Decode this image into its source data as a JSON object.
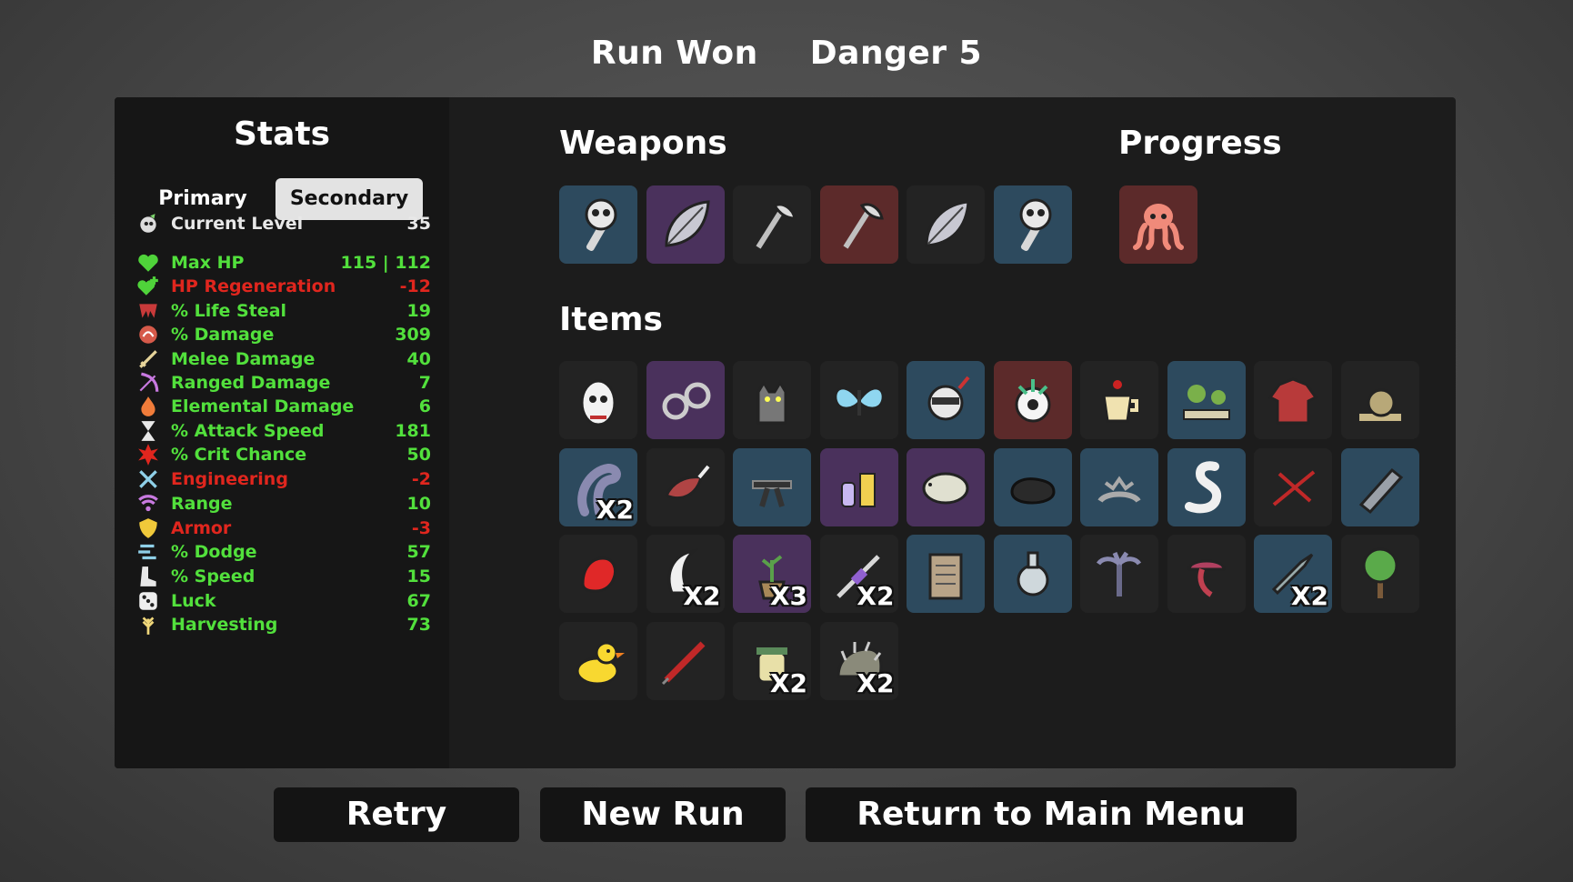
{
  "header": {
    "result": "Run Won",
    "danger": "Danger 5"
  },
  "stats": {
    "title": "Stats",
    "tab_primary": "Primary",
    "tab_secondary": "Secondary",
    "rows": [
      {
        "label": "Current Level",
        "value": "35",
        "color": "white",
        "icon": "level-icon"
      },
      {
        "label": "Max HP",
        "value": "115 | 112",
        "color": "green",
        "icon": "heart-icon"
      },
      {
        "label": "HP Regeneration",
        "value": "-12",
        "color": "red",
        "icon": "heart-plus-icon"
      },
      {
        "label": "% Life Steal",
        "value": "19",
        "color": "green",
        "icon": "fangs-icon"
      },
      {
        "label": "% Damage",
        "value": "309",
        "color": "green",
        "icon": "muscle-icon"
      },
      {
        "label": "Melee Damage",
        "value": "40",
        "color": "green",
        "icon": "sword-icon"
      },
      {
        "label": "Ranged Damage",
        "value": "7",
        "color": "green",
        "icon": "bow-icon"
      },
      {
        "label": "Elemental Damage",
        "value": "6",
        "color": "green",
        "icon": "flame-icon"
      },
      {
        "label": "% Attack Speed",
        "value": "181",
        "color": "green",
        "icon": "hourglass-icon"
      },
      {
        "label": "% Crit Chance",
        "value": "50",
        "color": "green",
        "icon": "crit-icon"
      },
      {
        "label": "Engineering",
        "value": "-2",
        "color": "red",
        "icon": "wrench-icon"
      },
      {
        "label": "Range",
        "value": "10",
        "color": "green",
        "icon": "range-icon"
      },
      {
        "label": "Armor",
        "value": "-3",
        "color": "red",
        "icon": "shield-icon"
      },
      {
        "label": "% Dodge",
        "value": "57",
        "color": "green",
        "icon": "dodge-icon"
      },
      {
        "label": "% Speed",
        "value": "15",
        "color": "green",
        "icon": "boot-icon"
      },
      {
        "label": "Luck",
        "value": "67",
        "color": "green",
        "icon": "dice-icon"
      },
      {
        "label": "Harvesting",
        "value": "73",
        "color": "green",
        "icon": "wheat-icon"
      }
    ]
  },
  "weapons": {
    "title": "Weapons",
    "items": [
      {
        "icon": "skull-wrench-icon",
        "tier": "tier2"
      },
      {
        "icon": "leaf-blade-icon",
        "tier": "tier3"
      },
      {
        "icon": "axe-icon",
        "tier": "tier1"
      },
      {
        "icon": "axe-icon",
        "tier": "tier4"
      },
      {
        "icon": "leaf-blade-icon",
        "tier": "tier1"
      },
      {
        "icon": "skull-wrench-icon",
        "tier": "tier2"
      }
    ]
  },
  "progress": {
    "title": "Progress",
    "items": [
      {
        "icon": "octopus-icon",
        "tier": "tier4"
      }
    ]
  },
  "items": {
    "title": "Items",
    "rows": [
      [
        {
          "icon": "egg-icon",
          "tier": "tier1",
          "qty": ""
        },
        {
          "icon": "handcuffs-icon",
          "tier": "tier3",
          "qty": ""
        },
        {
          "icon": "cat-icon",
          "tier": "tier1",
          "qty": ""
        },
        {
          "icon": "butterfly-icon",
          "tier": "tier1",
          "qty": ""
        },
        {
          "icon": "robot-icon",
          "tier": "tier2",
          "qty": ""
        },
        {
          "icon": "alien-eye-icon",
          "tier": "tier4",
          "qty": ""
        },
        {
          "icon": "coffee-icon",
          "tier": "tier1",
          "qty": ""
        },
        {
          "icon": "garden-icon",
          "tier": "tier2",
          "qty": ""
        },
        {
          "icon": "shirt-icon",
          "tier": "tier1",
          "qty": ""
        },
        {
          "icon": "snail-icon",
          "tier": "tier1",
          "qty": ""
        }
      ],
      [
        {
          "icon": "tentacle-icon",
          "tier": "tier2",
          "qty": "X2"
        },
        {
          "icon": "meat-icon",
          "tier": "tier1",
          "qty": ""
        },
        {
          "icon": "black-belt-icon",
          "tier": "tier2",
          "qty": ""
        },
        {
          "icon": "potion-set-icon",
          "tier": "tier3",
          "qty": ""
        },
        {
          "icon": "tardigrade-icon",
          "tier": "tier3",
          "qty": ""
        },
        {
          "icon": "stone-icon",
          "tier": "tier2",
          "qty": ""
        },
        {
          "icon": "crown-icon",
          "tier": "tier2",
          "qty": ""
        },
        {
          "icon": "worm-icon",
          "tier": "tier2",
          "qty": ""
        },
        {
          "icon": "scar-icon",
          "tier": "tier1",
          "qty": ""
        },
        {
          "icon": "plank-icon",
          "tier": "tier2",
          "qty": ""
        }
      ],
      [
        {
          "icon": "glove-icon",
          "tier": "tier1",
          "qty": ""
        },
        {
          "icon": "claw-icon",
          "tier": "tier1",
          "qty": "X2"
        },
        {
          "icon": "plant-pot-icon",
          "tier": "tier3",
          "qty": "X3"
        },
        {
          "icon": "syringe-sword-icon",
          "tier": "tier1",
          "qty": "X2"
        },
        {
          "icon": "scroll-icon",
          "tier": "tier2",
          "qty": ""
        },
        {
          "icon": "flask-icon",
          "tier": "tier2",
          "qty": ""
        },
        {
          "icon": "palm-tree-icon",
          "tier": "tier1",
          "qty": ""
        },
        {
          "icon": "mushroom-icon",
          "tier": "tier1",
          "qty": ""
        },
        {
          "icon": "bullet-icon",
          "tier": "tier2",
          "qty": "X2"
        },
        {
          "icon": "tree-icon",
          "tier": "tier1",
          "qty": ""
        }
      ],
      [
        {
          "icon": "duck-icon",
          "tier": "tier1",
          "qty": ""
        },
        {
          "icon": "syringe-icon",
          "tier": "tier1",
          "qty": ""
        },
        {
          "icon": "honey-jar-icon",
          "tier": "tier1",
          "qty": "X2"
        },
        {
          "icon": "hedgehog-icon",
          "tier": "tier1",
          "qty": "X2"
        }
      ]
    ]
  },
  "buttons": {
    "retry": "Retry",
    "new_run": "New Run",
    "main_menu": "Return to Main Menu"
  }
}
